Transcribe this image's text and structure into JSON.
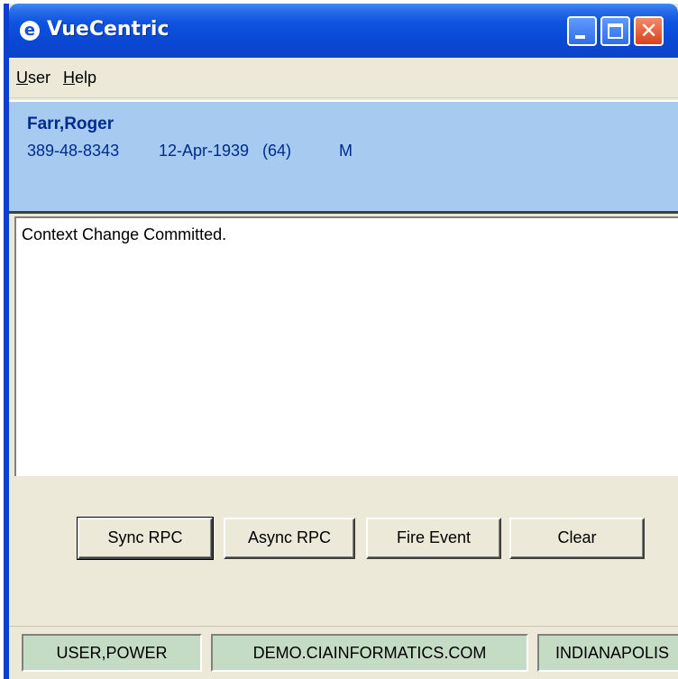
{
  "window": {
    "title": "VueCentric",
    "app_icon": "e-globe-icon"
  },
  "menu": {
    "items": [
      {
        "label": "User"
      },
      {
        "label": "Help"
      }
    ]
  },
  "patient": {
    "name": "Farr,Roger",
    "ssn": "389-48-8343",
    "dob": "12-Apr-1939",
    "age": "(64)",
    "sex": "M"
  },
  "log": {
    "lines": [
      "Context Change Committed."
    ]
  },
  "buttons": {
    "sync_rpc": "Sync RPC",
    "async_rpc": "Async RPC",
    "fire_event": "Fire Event",
    "clear": "Clear"
  },
  "status": {
    "user": "USER,POWER",
    "domain": "DEMO.CIAINFORMATICS.COM",
    "location": "INDIANAPOLIS"
  },
  "colors": {
    "titlebar": "#0a48d4",
    "patient_panel": "#a6caf0",
    "patient_text": "#002a8c",
    "status_panel": "#c4dcc4",
    "close_button": "#d9411c"
  }
}
